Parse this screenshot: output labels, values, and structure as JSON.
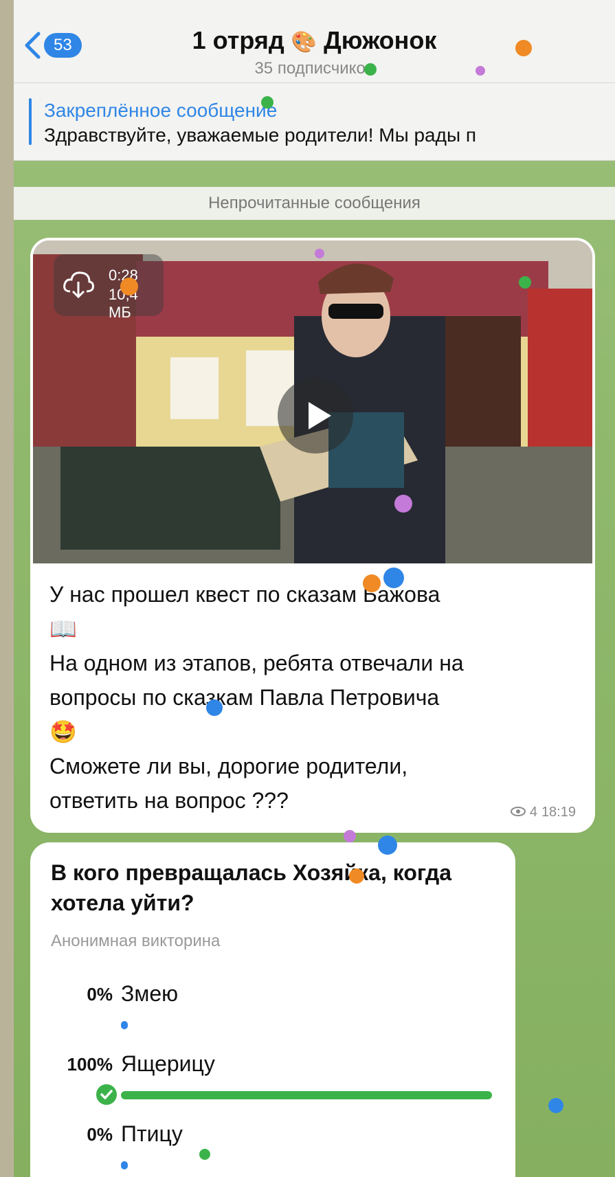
{
  "header": {
    "back_count": "53",
    "title_prefix": "1 отряд",
    "title_emoji": "🎨",
    "title_suffix": "Дюжонок",
    "subtitle": "35 подписчиков"
  },
  "pinned": {
    "title": "Закреплённое сообщение",
    "text": "Здравствуйте, уважаемые родители! Мы рады п"
  },
  "unread_label": "Непрочитанные сообщения",
  "message": {
    "video": {
      "duration": "0:28",
      "size": "10,4 МБ"
    },
    "lines": [
      "У нас прошел квест по сказам Бажова",
      "📖",
      "На одном из этапов, ребята отвечали на",
      "вопросы по сказкам Павла Петровича",
      "🤩",
      "Сможете ли вы, дорогие родители,",
      "ответить на вопрос ???"
    ],
    "views": "4",
    "time": "18:19"
  },
  "poll": {
    "question": "В кого превращалась Хозяйка, когда хотела уйти?",
    "type": "Анонимная викторина",
    "options": [
      {
        "pct": "0%",
        "label": "Змею",
        "share": 0
      },
      {
        "pct": "100%",
        "label": "Ящерицу",
        "share": 1.0,
        "correct": true
      },
      {
        "pct": "0%",
        "label": "Птицу",
        "share": 0
      }
    ]
  },
  "colors": {
    "accent": "#2f86e6",
    "correct": "#3cb34a",
    "chat_bg": "#8fb86c"
  }
}
